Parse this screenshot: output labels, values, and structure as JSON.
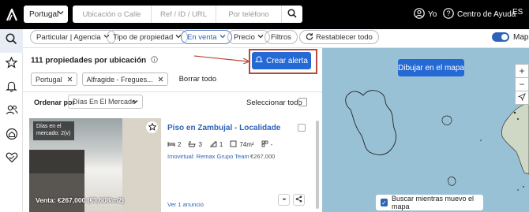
{
  "topbar": {
    "country": "Portugal",
    "search_location_placeholder": "Ubicación o Calle",
    "search_ref_placeholder": "Ref / ID / URL",
    "search_phone_placeholder": "Por teléfono",
    "user_label": "Yo",
    "help_label": "Centro de Ayuda",
    "language": "ES"
  },
  "filters": {
    "advertiser": "Particular | Agencia",
    "property_type": "Tipo de propiedad",
    "operation": "En venta",
    "price": "Precio",
    "filters": "Filtros",
    "reset": "Restablecer todo",
    "map_toggle_label": "Mapa"
  },
  "results": {
    "count_text": "111 propiedades por ubicación",
    "alert_button": "Crear alerta",
    "chips": [
      "Portugal",
      "Alfragide - Fregues..."
    ],
    "clear_all": "Borrar todo",
    "sort_label": "Ordenar por",
    "sort_value": "Días En El Mercado",
    "select_all": "Seleccionar todo"
  },
  "listing": {
    "days_tag": "Días en el mercado: 2(v)",
    "sale_price": "Venta: €267,000 (€3,608/m2)",
    "title": "Piso en Zambujal - Localidade",
    "bedrooms": "2",
    "bathrooms": "3",
    "floor": "1",
    "area": "74m²",
    "extra": "-",
    "agency": "Imovirtual: Remax Grupo Team",
    "price": "€267,000",
    "more_link": "Ver 1 anuncio",
    "more_actions": "•••"
  },
  "map": {
    "draw_button": "Dibujar en el mapa",
    "zoom_in": "+",
    "zoom_out": "−",
    "search_on_move": "Buscar mientras muevo el mapa"
  },
  "colors": {
    "accent": "#2569d4",
    "topbar": "#000000",
    "highlight_box": "#b74a3a",
    "map_water": "#99c1d6"
  }
}
